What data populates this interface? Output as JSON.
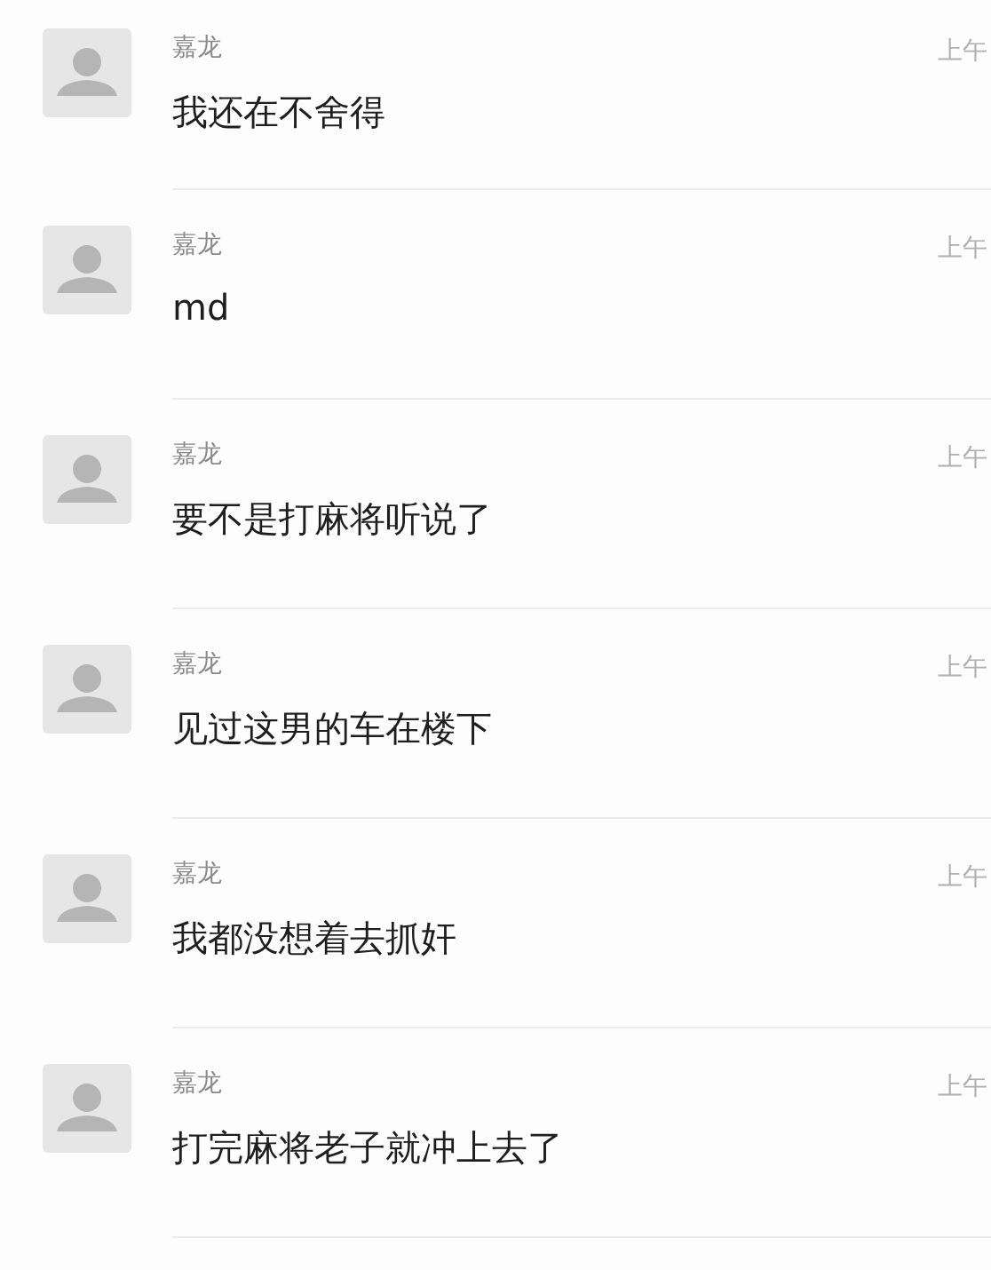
{
  "messages": [
    {
      "sender": "嘉龙",
      "time": "上午",
      "text": "我还在不舍得"
    },
    {
      "sender": "嘉龙",
      "time": "上午",
      "text": "md"
    },
    {
      "sender": "嘉龙",
      "time": "上午",
      "text": "要不是打麻将听说了"
    },
    {
      "sender": "嘉龙",
      "time": "上午",
      "text": "见过这男的车在楼下"
    },
    {
      "sender": "嘉龙",
      "time": "上午",
      "text": "我都没想着去抓奸"
    },
    {
      "sender": "嘉龙",
      "time": "上午",
      "text": "打完麻将老子就冲上去了"
    }
  ]
}
